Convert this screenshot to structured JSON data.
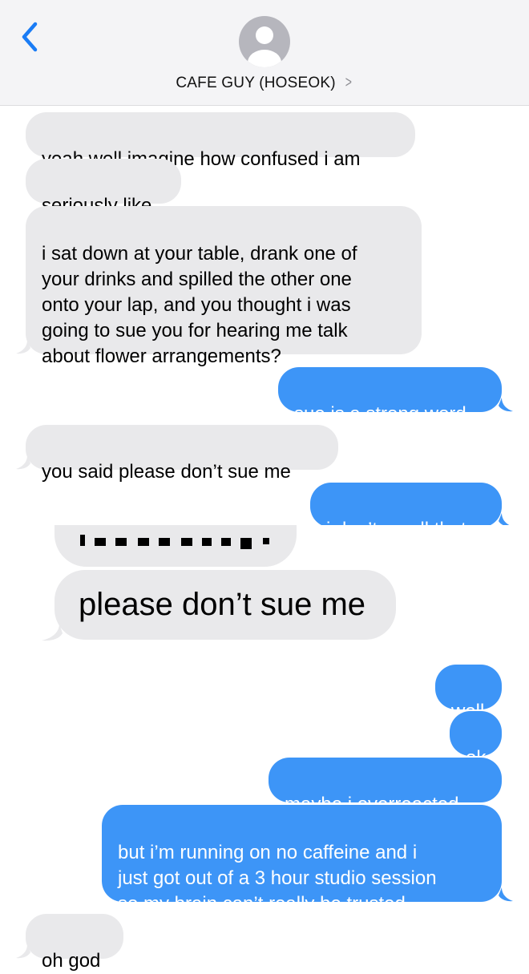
{
  "header": {
    "contact_name": "CAFE GUY (HOSEOK)",
    "back_icon": "chevron-left-icon",
    "avatar_icon": "person-silhouette-icon",
    "chevron_icon": "chevron-right-icon"
  },
  "messages": [
    {
      "direction": "incoming",
      "text": "yeah well imagine how confused i am"
    },
    {
      "direction": "incoming",
      "text": "seriously like"
    },
    {
      "direction": "incoming",
      "text": "i sat down at your table, drank one of\nyour drinks and spilled the other one\nonto your lap, and you thought i was\ngoing to sue you for hearing me talk\nabout flower arrangements?"
    },
    {
      "direction": "outgoing",
      "text": "sue is a strong word"
    },
    {
      "direction": "incoming",
      "text": "you said please don’t sue me"
    },
    {
      "direction": "outgoing",
      "text": "i don’t recall that"
    },
    {
      "direction": "incoming",
      "text": "please don’t sue me",
      "is_screenshot": true
    },
    {
      "direction": "outgoing",
      "text": "well"
    },
    {
      "direction": "outgoing",
      "text": "ok"
    },
    {
      "direction": "outgoing",
      "text": "maybe i overreacted"
    },
    {
      "direction": "outgoing",
      "text": "but i’m running on no caffeine and i\njust got out of a 3 hour studio session\nso my brain can’t really be trusted"
    },
    {
      "direction": "incoming",
      "text": "oh god"
    }
  ],
  "colors": {
    "outgoing_bubble": "#3d95f7",
    "incoming_bubble": "#e9e9eb",
    "accent": "#1a7cf5",
    "header_bg": "#f4f4f6"
  }
}
